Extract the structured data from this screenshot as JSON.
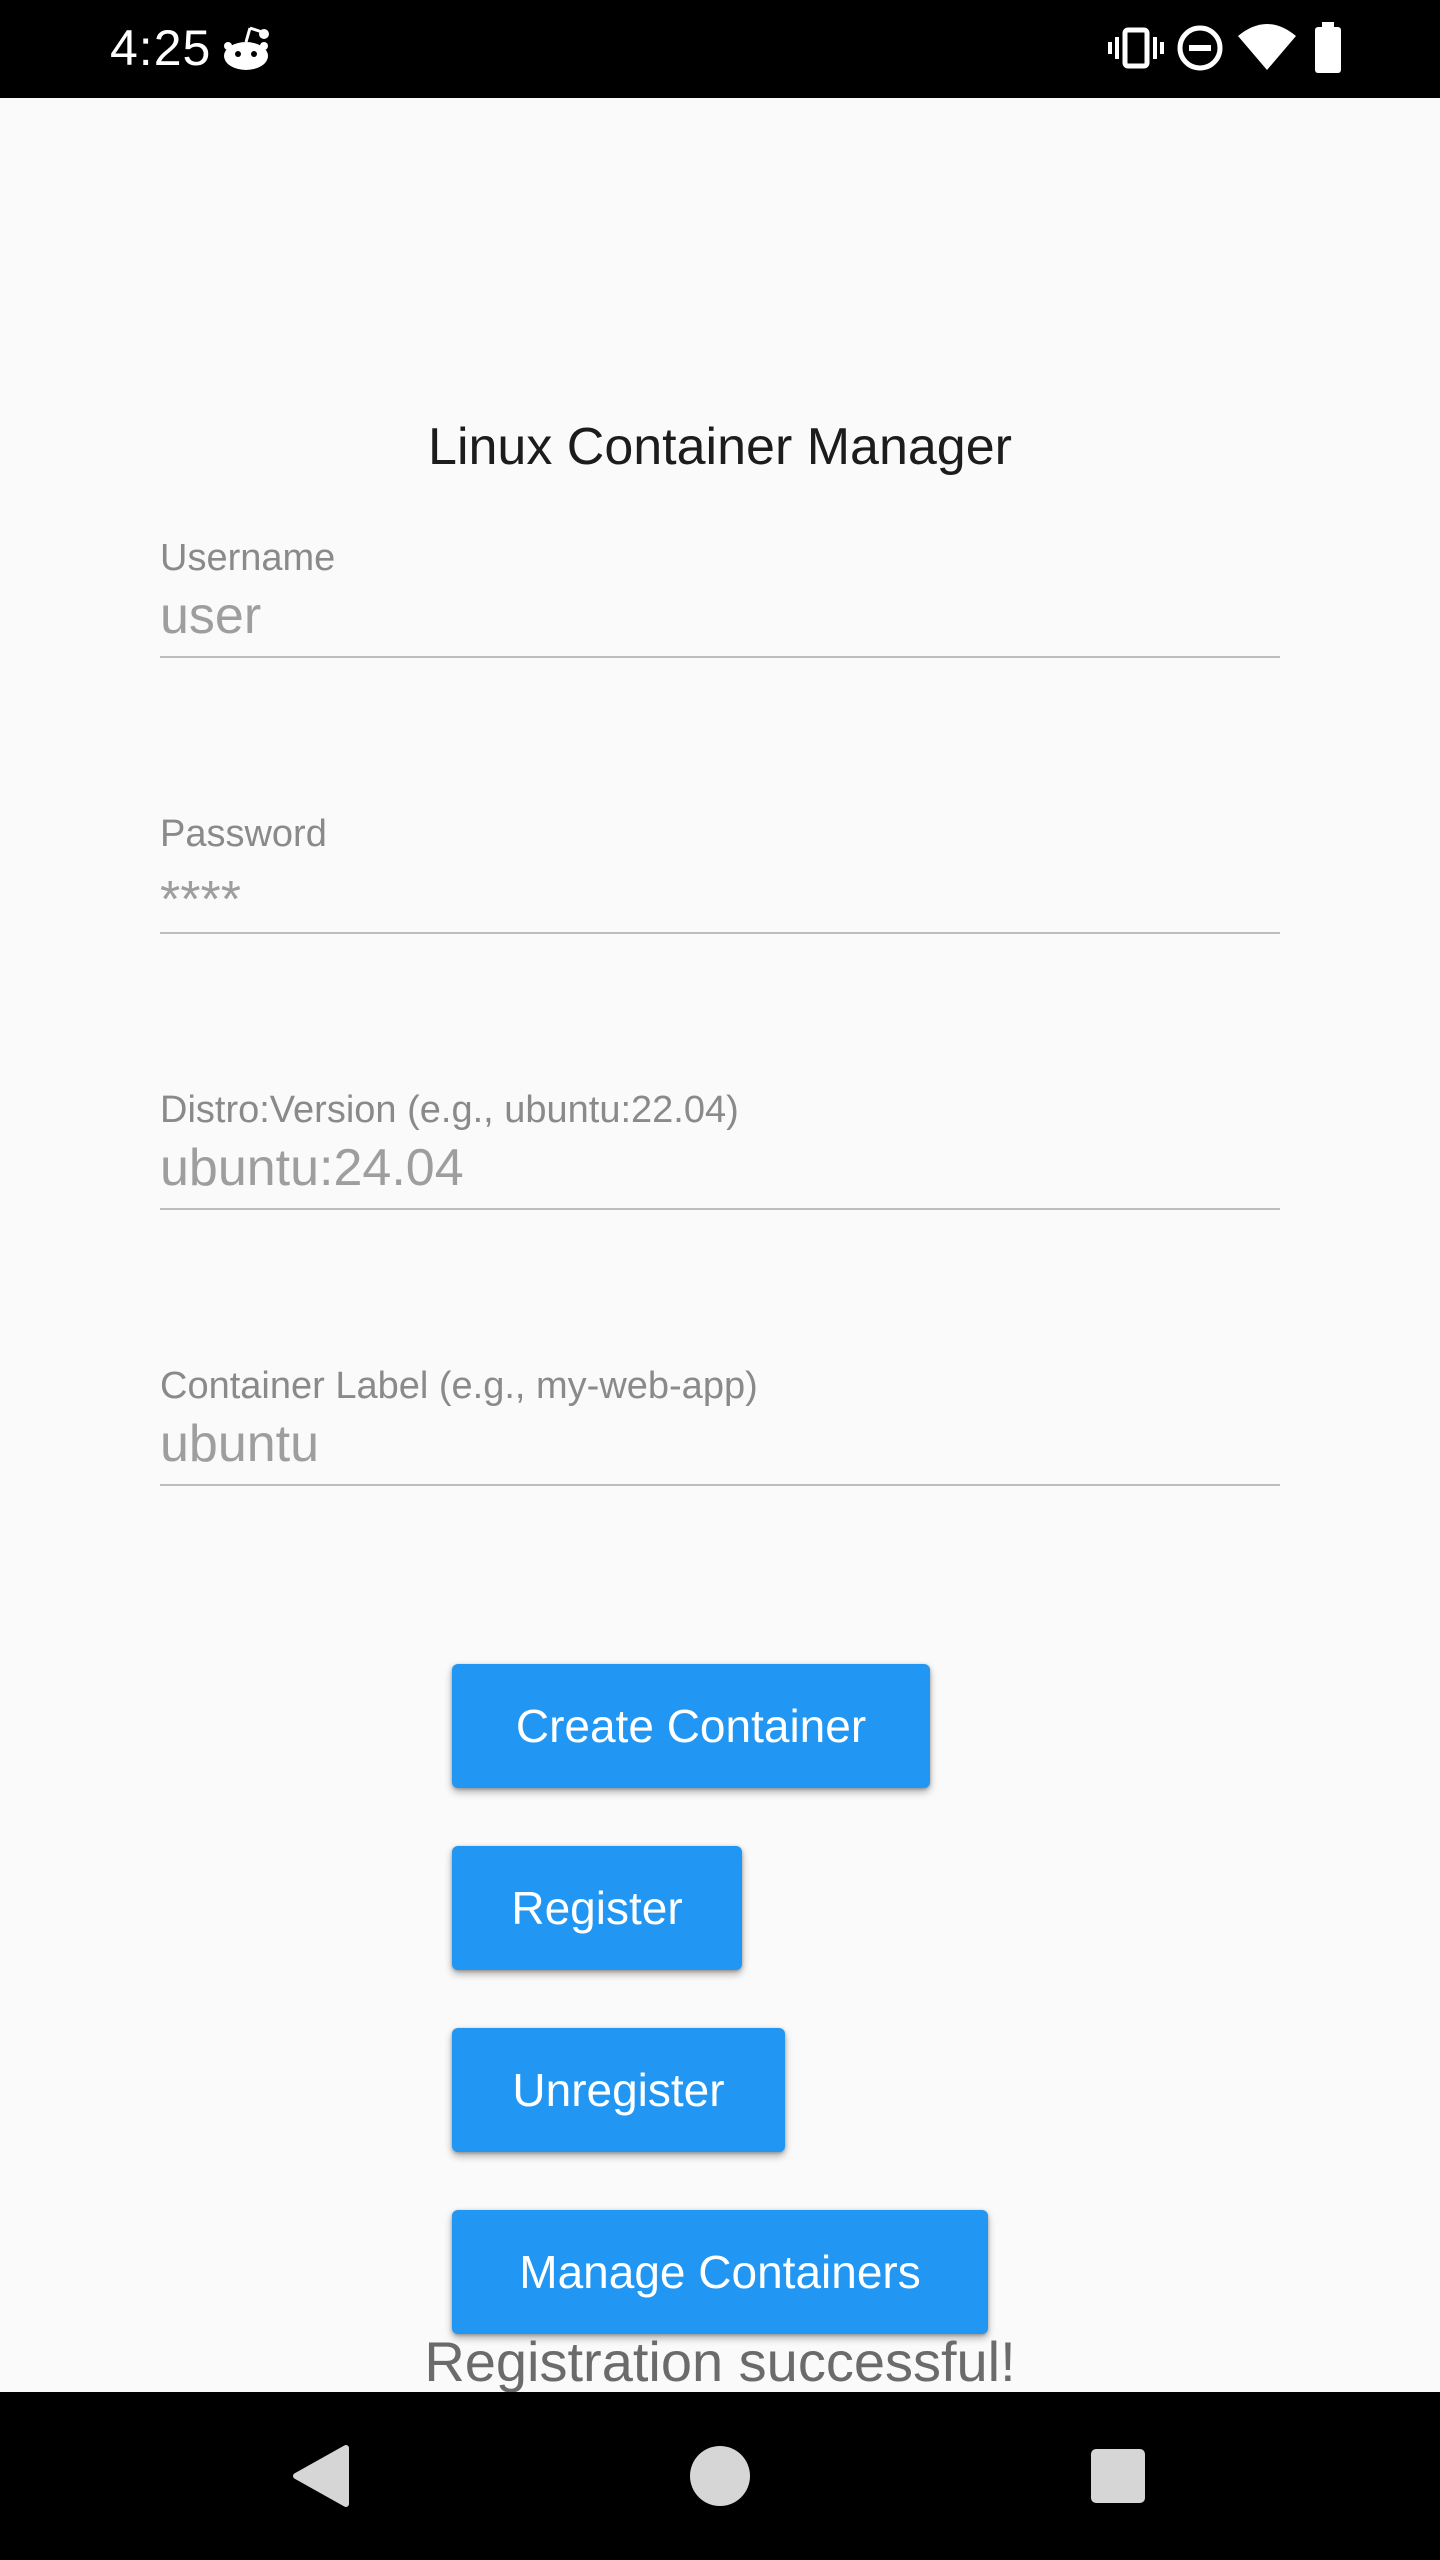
{
  "status_bar": {
    "time": "4:25",
    "icons": [
      "reddit-notification-icon",
      "vibrate-icon",
      "do-not-disturb-icon",
      "wifi-icon",
      "battery-icon"
    ]
  },
  "app": {
    "title": "Linux Container Manager"
  },
  "form": {
    "username": {
      "label": "Username",
      "value": "user"
    },
    "password": {
      "label": "Password",
      "value": "****"
    },
    "distro": {
      "label": "Distro:Version (e.g., ubuntu:22.04)",
      "value": "ubuntu:24.04"
    },
    "container_label": {
      "label": "Container Label (e.g., my-web-app)",
      "value": "ubuntu"
    }
  },
  "buttons": {
    "create": "Create Container",
    "register": "Register",
    "unregister": "Unregister",
    "manage": "Manage Containers"
  },
  "message": "Registration successful!",
  "colors": {
    "accent": "#2196f3",
    "background": "#fafafa",
    "system_bars": "#000000"
  },
  "nav_bar": {
    "icons": [
      "back-icon",
      "home-icon",
      "recents-icon"
    ]
  }
}
